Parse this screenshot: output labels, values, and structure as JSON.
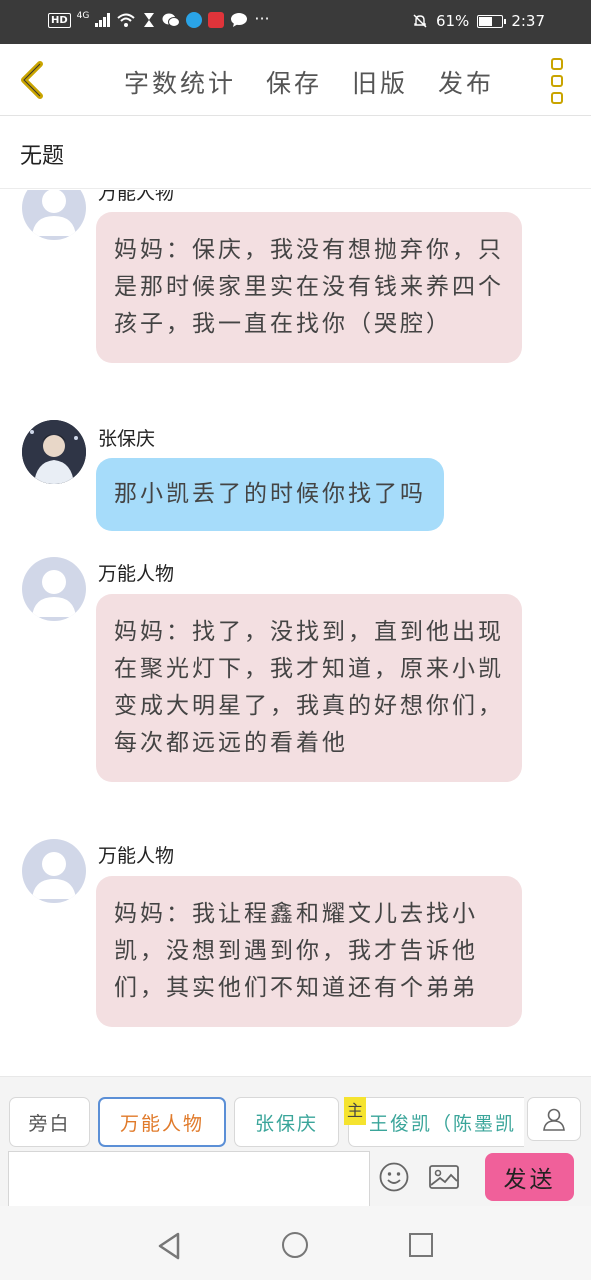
{
  "status_bar": {
    "hd": "HD",
    "network": "4G",
    "battery": "61%",
    "time": "2:37",
    "battery_level": 0.61,
    "dots": "···"
  },
  "header": {
    "menu": [
      "字数统计",
      "保存",
      "旧版",
      "发布"
    ]
  },
  "doc_title": "无题",
  "messages": [
    {
      "sender": "万能人物",
      "text": "妈妈：保庆，我没有想抛弃你，只是那时候家里实在没有钱来养四个孩子，我一直在找你（哭腔）",
      "style": "pink"
    },
    {
      "sender": "张保庆",
      "text": "那小凯丢了的时候你找了吗",
      "style": "blue"
    },
    {
      "sender": "万能人物",
      "text": "妈妈：找了，没找到，直到他出现在聚光灯下，我才知道，原来小凯变成大明星了，我真的好想你们，每次都远远的看着他",
      "style": "pink"
    },
    {
      "sender": "万能人物",
      "text": "妈妈：我让程鑫和耀文儿去找小凯，没想到遇到你，我才告诉他们，其实他们不知道还有个弟弟",
      "style": "pink"
    }
  ],
  "toolbar": {
    "chips": [
      "旁白",
      "万能人物",
      "张保庆",
      "王俊凯（陈墨凯"
    ],
    "main_badge": "主",
    "send_label": "发送",
    "input_value": ""
  },
  "colors": {
    "accent": "#c9a400",
    "pink_bubble": "#f3dfe1",
    "blue_bubble": "#a6dcfa",
    "send_button": "#f0609a"
  }
}
